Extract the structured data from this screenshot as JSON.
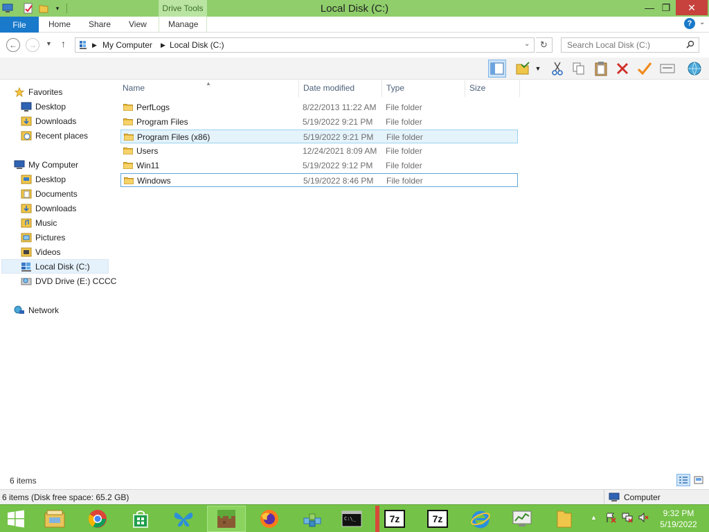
{
  "window": {
    "title": "Local Disk (C:)",
    "context_tab": "Drive Tools",
    "accent_color": "#8fce6b",
    "taskbar_color": "#74c247"
  },
  "ribbon": {
    "tabs": [
      "File",
      "Home",
      "Share",
      "View",
      "Manage"
    ],
    "help": "?"
  },
  "address": {
    "root": "My Computer",
    "current": "Local Disk (C:)",
    "search_placeholder": "Search Local Disk (C:)"
  },
  "nav": {
    "favorites": {
      "label": "Favorites",
      "items": [
        "Desktop",
        "Downloads",
        "Recent places"
      ]
    },
    "computer": {
      "label": "My Computer",
      "items": [
        "Desktop",
        "Documents",
        "Downloads",
        "Music",
        "Pictures",
        "Videos",
        "Local Disk (C:)",
        "DVD Drive (E:) CCCC"
      ]
    },
    "network": {
      "label": "Network"
    }
  },
  "list": {
    "columns": [
      "Name",
      "Date modified",
      "Type",
      "Size"
    ],
    "rows": [
      {
        "name": "PerfLogs",
        "date": "8/22/2013 11:22 AM",
        "type": "File folder"
      },
      {
        "name": "Program Files",
        "date": "5/19/2022 9:21 PM",
        "type": "File folder"
      },
      {
        "name": "Program Files (x86)",
        "date": "5/19/2022 9:21 PM",
        "type": "File folder"
      },
      {
        "name": "Users",
        "date": "12/24/2021 8:09 AM",
        "type": "File folder"
      },
      {
        "name": "Win11",
        "date": "5/19/2022 9:12 PM",
        "type": "File folder"
      },
      {
        "name": "Windows",
        "date": "5/19/2022 8:46 PM",
        "type": "File folder"
      }
    ]
  },
  "status": {
    "items_count": "6 items",
    "bar_text": "6 items (Disk free space: 65.2 GB)",
    "location": "Computer"
  },
  "taskbar": {
    "clock_time": "9:32 PM",
    "clock_date": "5/19/2022",
    "seven_zip": "7z"
  }
}
